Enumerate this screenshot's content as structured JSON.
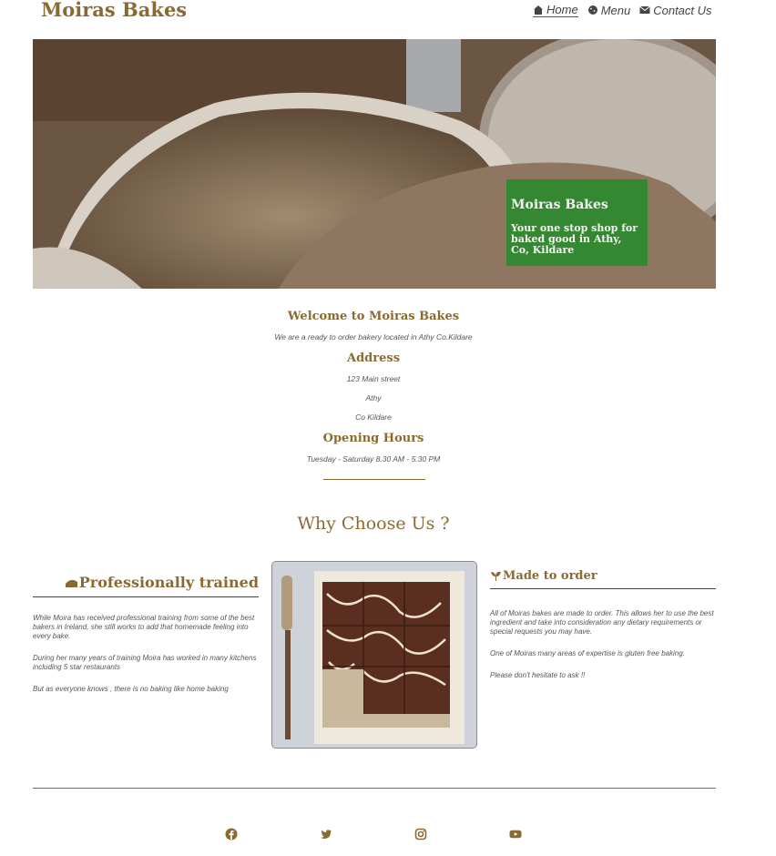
{
  "brand": "Moiras Bakes",
  "nav": [
    {
      "label": "Home",
      "icon": "home-icon",
      "active": true
    },
    {
      "label": "Menu",
      "icon": "cookie-icon"
    },
    {
      "label": "Contact Us",
      "icon": "envelope-icon"
    }
  ],
  "hero": {
    "title": "Moiras Bakes",
    "tagline": "Your one stop shop for baked good in Athy, Co, Kildare"
  },
  "welcome": {
    "heading": "Welcome to Moiras Bakes",
    "text": "We are a ready to order bakery located in Athy Co.Kildare"
  },
  "address": {
    "heading": "Address",
    "line1": "123 Main street",
    "line2": "Athy",
    "line3": "Co Kildare"
  },
  "hours": {
    "heading": "Opening Hours",
    "text": "Tuesday - Saturday 8.30 AM - 5.30 PM"
  },
  "why": {
    "heading": "Why Choose Us ?",
    "left": {
      "title": "Professionally trained",
      "p1": "While Moira has received professional training from some of the best bakers in Ireland, she still works to add that homemade feeling into every bake.",
      "p2": "During her many years of training Moira has worked in many kitchens including 5 star restaurants",
      "p3": "But as everyone knows , there is no baking like home baking"
    },
    "right": {
      "title": "Made to order",
      "p1": "All of Moiras bakes are made to order. This allows her to use the best ingredient and take into consideration any dietary requirements or special requests you may have.",
      "p2": "One of Moiras many areas of expertise is gluten free baking.",
      "p3": "Please don't hesitate to ask !!"
    }
  },
  "social": [
    "facebook-icon",
    "twitter-icon",
    "instagram-icon",
    "youtube-icon"
  ],
  "colors": {
    "accent": "#8a6a32",
    "hero_box": "#2f8a2f"
  }
}
